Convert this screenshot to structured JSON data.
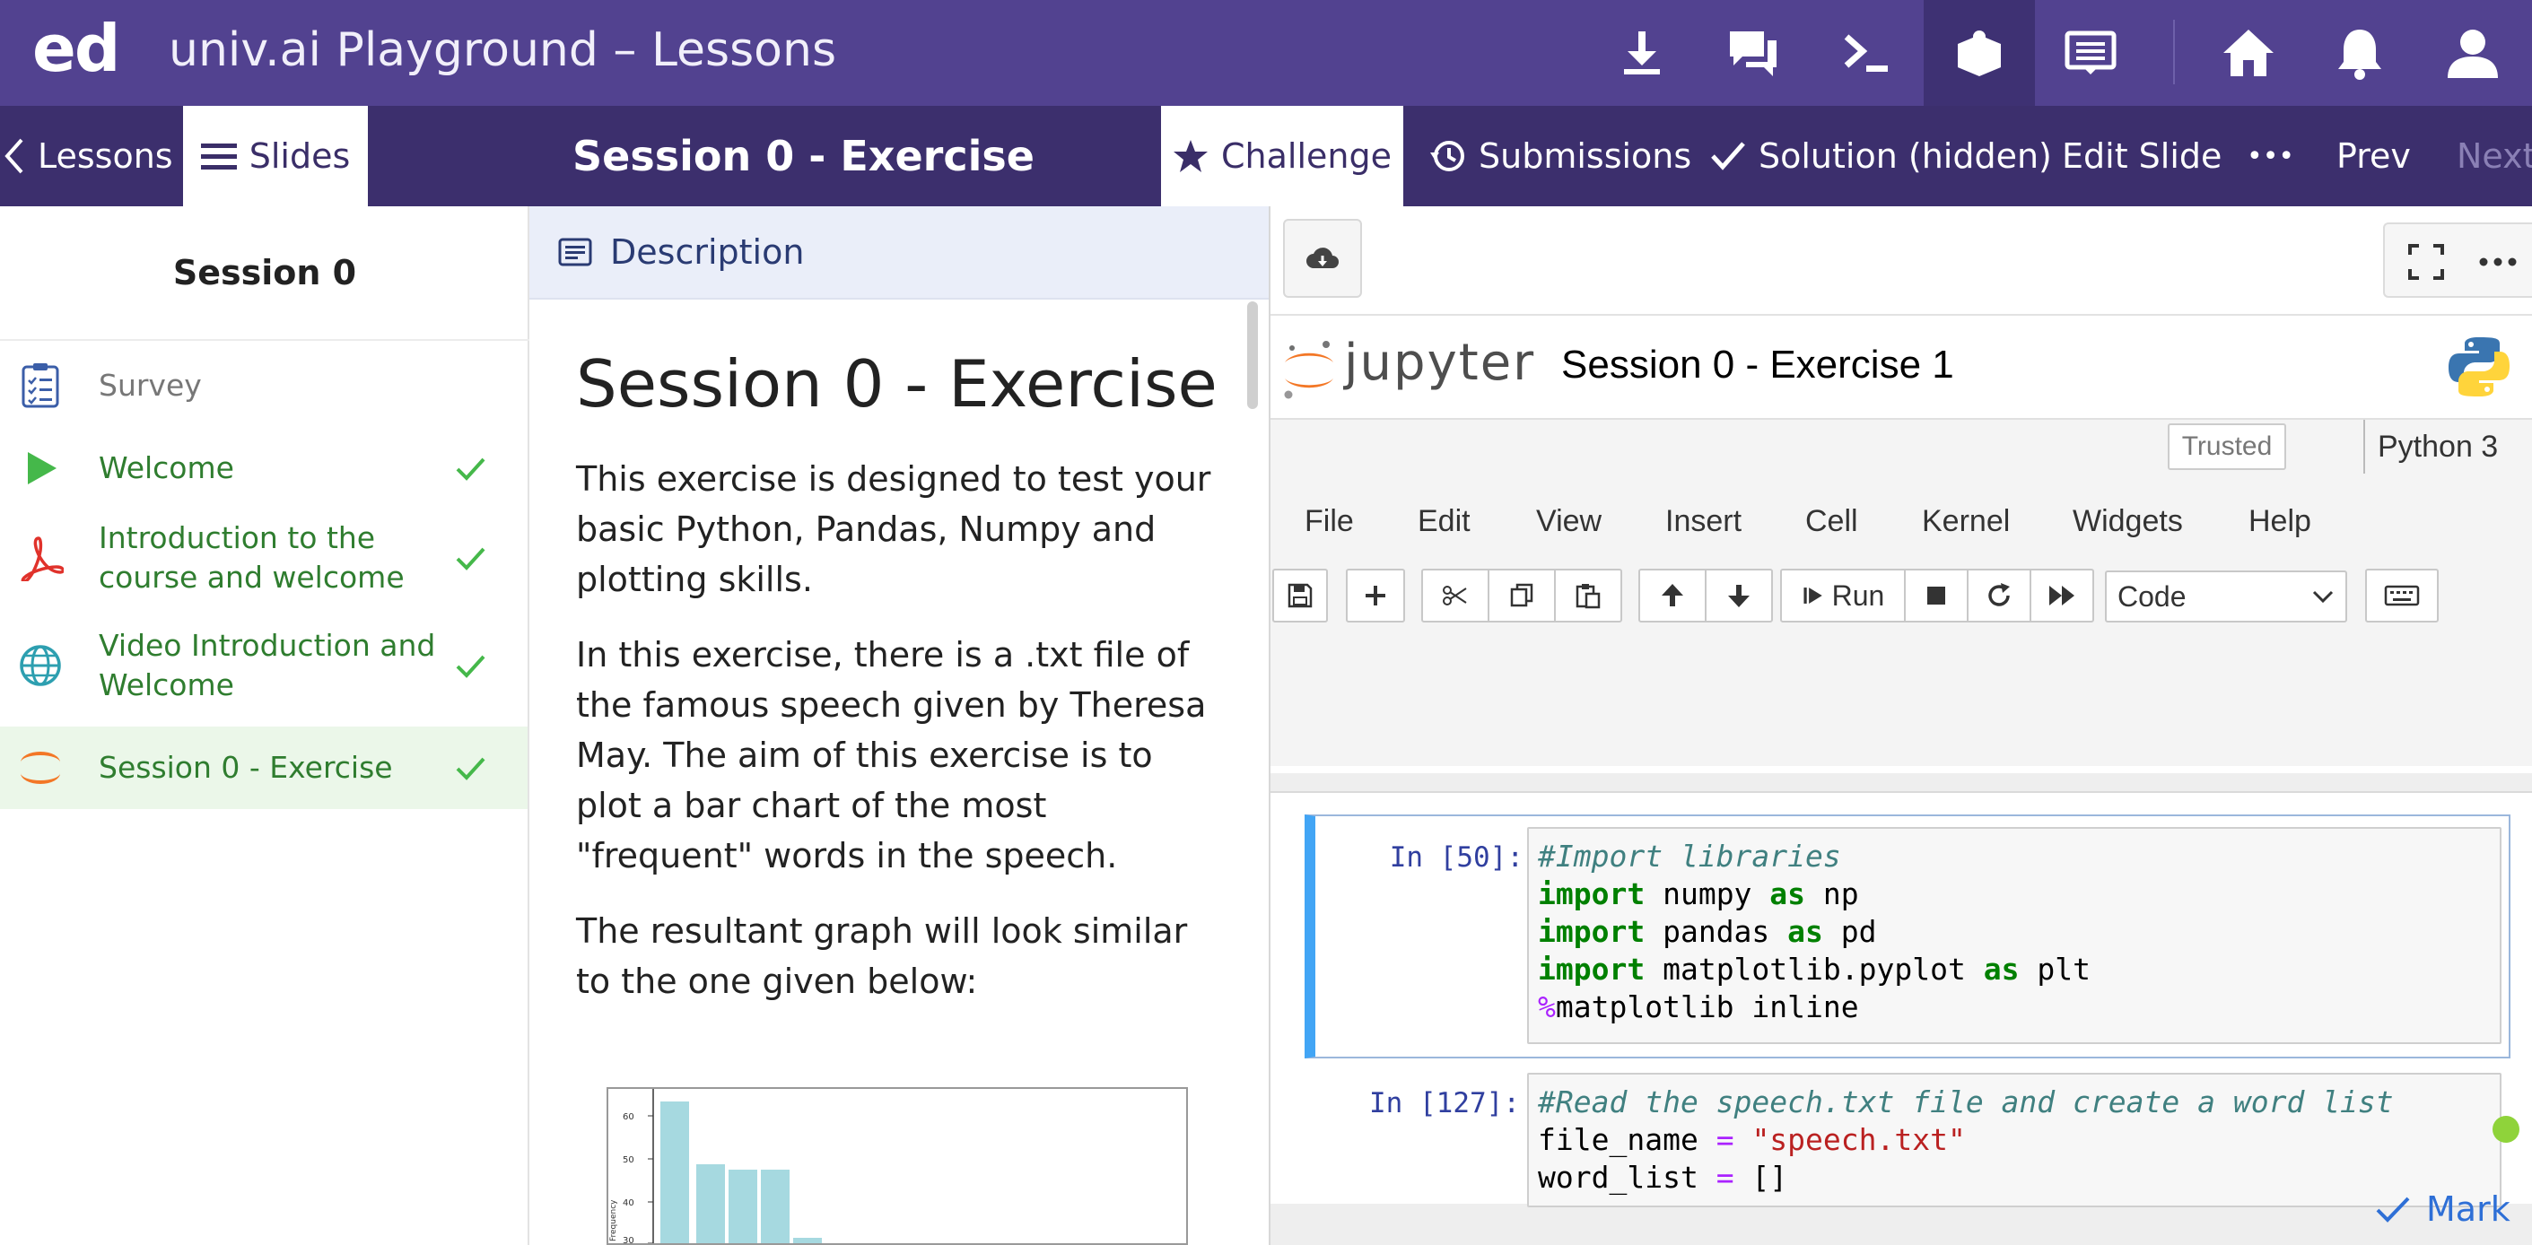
{
  "topbar": {
    "logo": "ed",
    "title": "univ.ai Playground – Lessons",
    "icons": [
      "download-icon",
      "chat-icon",
      "terminal-icon",
      "lesson-icon",
      "workspace-icon",
      "home-icon",
      "bell-icon",
      "user-icon"
    ]
  },
  "subbar": {
    "lessons": "Lessons",
    "slides": "Slides",
    "slide_title": "Session 0 - Exercise",
    "challenge": "Challenge",
    "submissions": "Submissions",
    "solution": "Solution (hidden)",
    "edit_slide": "Edit Slide",
    "more": "•••",
    "prev": "Prev",
    "next": "Next"
  },
  "sidebar": {
    "title": "Session 0",
    "items": [
      {
        "label": "Survey",
        "type": "survey",
        "done": false
      },
      {
        "label": "Welcome",
        "type": "video",
        "done": true
      },
      {
        "label": "Introduction to the course and welcome",
        "type": "pdf",
        "done": true
      },
      {
        "label": "Video Introduction and Welcome",
        "type": "web",
        "done": true
      },
      {
        "label": "Session 0 - Exercise",
        "type": "jupyter",
        "done": true,
        "active": true
      }
    ]
  },
  "description": {
    "header": "Description",
    "heading": "Session 0 - Exercise",
    "paragraphs": [
      "This exercise is designed to test your basic Python, Pandas, Numpy and plotting skills.",
      "In this exercise, there is a .txt file of the famous speech given by Theresa May. The aim of this exercise is to plot a bar chart of the most \"frequent\" words in the speech.",
      "The resultant graph will look similar to the one given below:"
    ]
  },
  "notebook": {
    "brand": "jupyter",
    "name": "Session 0 - Exercise 1",
    "trusted": "Trusted",
    "kernel": "Python 3",
    "menu": [
      "File",
      "Edit",
      "View",
      "Insert",
      "Cell",
      "Kernel",
      "Widgets",
      "Help"
    ],
    "run_label": "Run",
    "cell_type": "Code",
    "cells": [
      {
        "prompt": "In [50]:"
      },
      {
        "prompt": "In [127]:"
      }
    ],
    "mark": "Mark",
    "colors": {
      "accent": "#524290",
      "status": "#8fd33a",
      "selected_cell": "#42a5f5"
    }
  }
}
